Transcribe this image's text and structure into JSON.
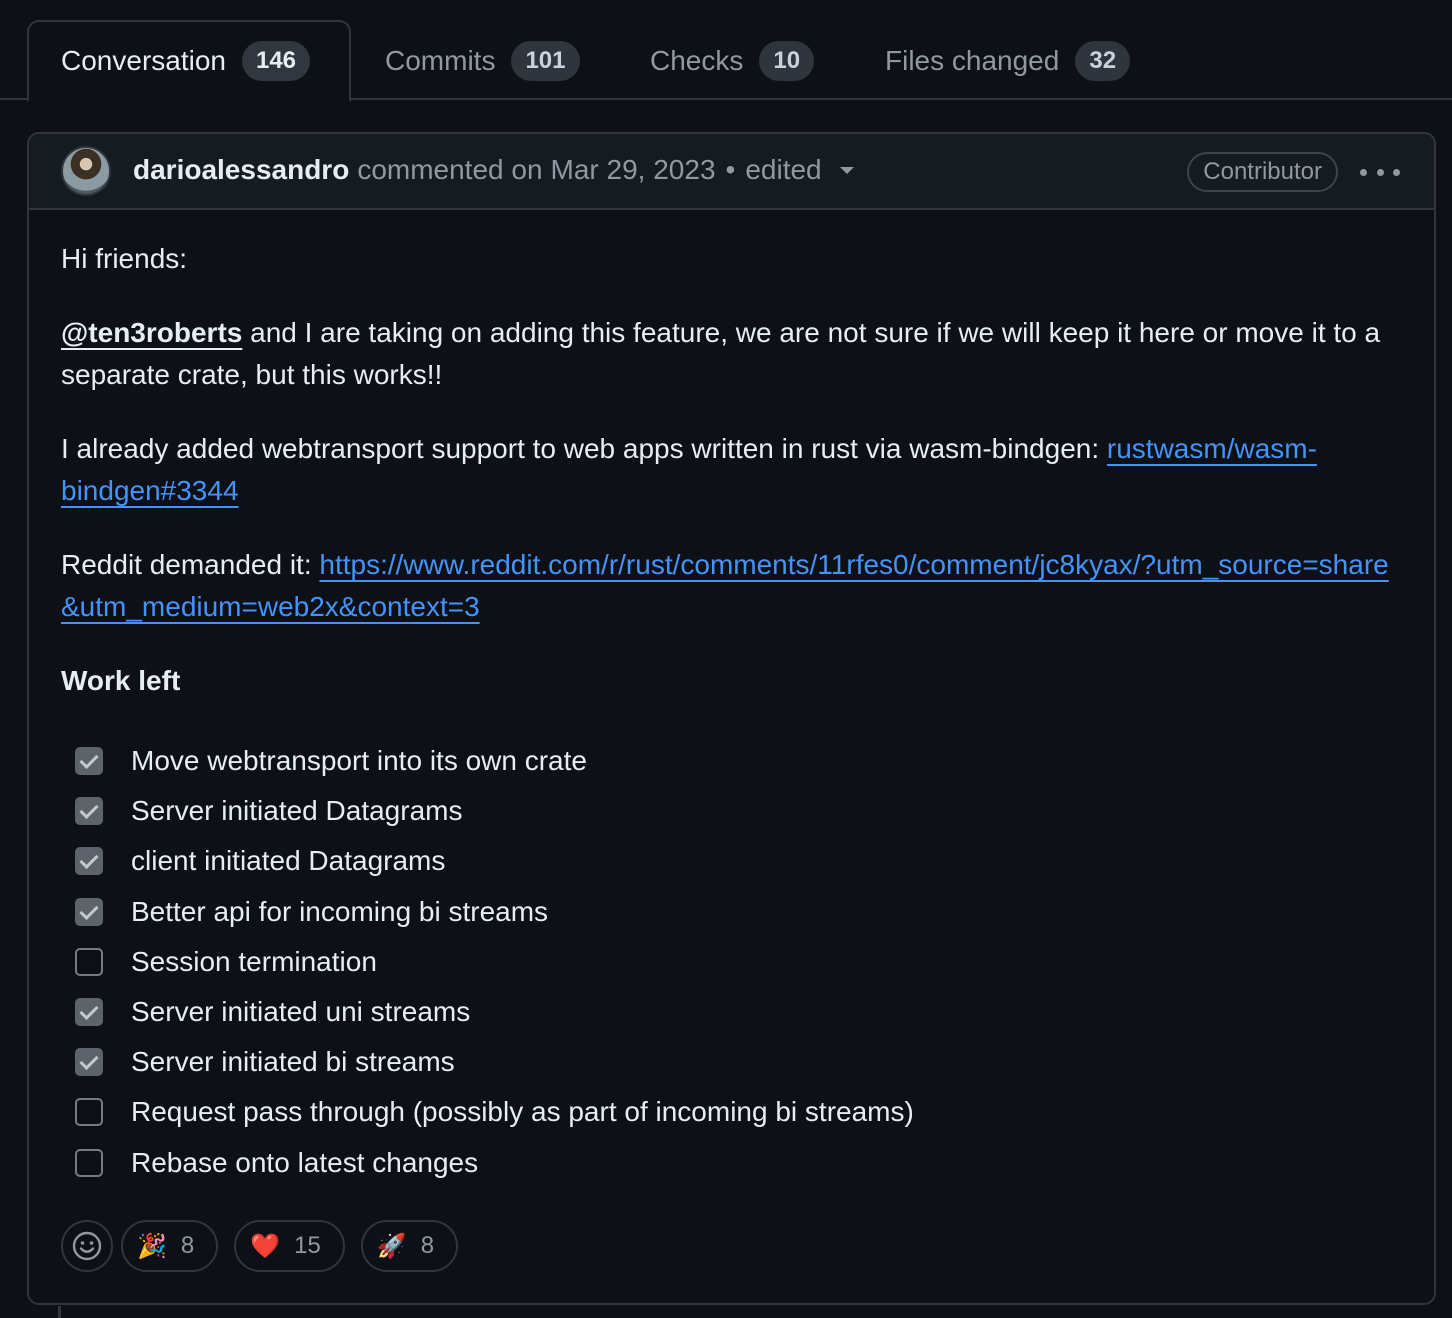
{
  "tabs": [
    {
      "label": "Conversation",
      "count": "146"
    },
    {
      "label": "Commits",
      "count": "101"
    },
    {
      "label": "Checks",
      "count": "10"
    },
    {
      "label": "Files changed",
      "count": "32"
    }
  ],
  "comment": {
    "author": "darioalessandro",
    "action": "commented on",
    "date": "Mar 29, 2023",
    "separator": "•",
    "edited": "edited",
    "role_badge": "Contributor",
    "greeting": "Hi friends:",
    "mention": "@ten3roberts",
    "para1_rest": " and I are taking on adding this feature, we are not sure if we will keep it here or move it to a separate crate, but this works!!",
    "para2_text": "I already added webtransport support to web apps written in rust via wasm-bindgen: ",
    "para2_link": "rustwasm/wasm-bindgen#3344",
    "para3_text": "Reddit demanded it: ",
    "para3_link": "https://www.reddit.com/r/rust/comments/11rfes0/comment/jc8kyax/?utm_source=share&utm_medium=web2x&context=3",
    "heading": "Work left",
    "tasks": [
      {
        "label": "Move webtransport into its own crate",
        "checked": true
      },
      {
        "label": "Server initiated Datagrams",
        "checked": true
      },
      {
        "label": "client initiated Datagrams",
        "checked": true
      },
      {
        "label": "Better api for incoming bi streams",
        "checked": true
      },
      {
        "label": "Session termination",
        "checked": false
      },
      {
        "label": "Server initiated uni streams",
        "checked": true
      },
      {
        "label": "Server initiated bi streams",
        "checked": true
      },
      {
        "label": "Request pass through (possibly as part of incoming bi streams)",
        "checked": false
      },
      {
        "label": "Rebase onto latest changes",
        "checked": false
      }
    ]
  },
  "reactions": [
    {
      "emoji": "🎉",
      "name": "tada",
      "count": "8"
    },
    {
      "emoji": "❤️",
      "name": "heart",
      "count": "15"
    },
    {
      "emoji": "🚀",
      "name": "rocket",
      "count": "8"
    }
  ],
  "colors": {
    "background": "#0d1117",
    "header": "#161b22",
    "border": "#30363d",
    "link": "#4493f8",
    "muted": "#9198a1",
    "text": "#e6edf3"
  }
}
